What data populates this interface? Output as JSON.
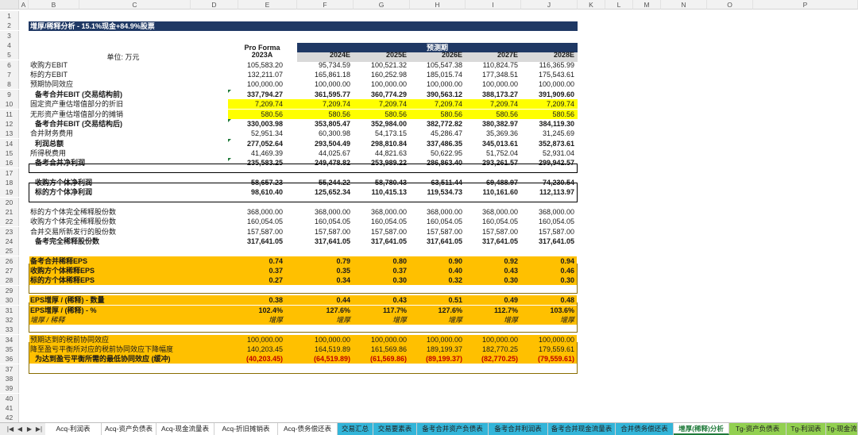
{
  "columns": [
    "A",
    "B",
    "C",
    "D",
    "E",
    "F",
    "G",
    "H",
    "I",
    "J",
    "K",
    "L",
    "M",
    "N",
    "O",
    "P"
  ],
  "title": "增厚/稀释分析 - 15.1%现金+84.9%股票",
  "unit_label": "单位: 万元",
  "proforma_label": "Pro Forma",
  "forecast_label": "预测期",
  "years": [
    "2023A",
    "2024E",
    "2025E",
    "2026E",
    "2027E",
    "2028E"
  ],
  "rows": [
    {
      "r": 6,
      "label": "收购方EBIT",
      "v": [
        "105,583.20",
        "95,734.59",
        "100,521.32",
        "105,547.38",
        "110,824.75",
        "116,365.99"
      ]
    },
    {
      "r": 7,
      "label": "标的方EBIT",
      "v": [
        "132,211.07",
        "165,861.18",
        "160,252.98",
        "185,015.74",
        "177,348.51",
        "175,543.61"
      ]
    },
    {
      "r": 8,
      "label": "预期协同效应",
      "v": [
        "100,000.00",
        "100,000.00",
        "100,000.00",
        "100,000.00",
        "100,000.00",
        "100,000.00"
      ]
    },
    {
      "r": 9,
      "label": "备考合并EBIT (交易结构前)",
      "v": [
        "337,794.27",
        "361,595.77",
        "360,774.29",
        "390,563.12",
        "388,173.27",
        "391,909.60"
      ],
      "bold": true,
      "indent": true
    },
    {
      "r": 10,
      "label": "固定资产重估增值部分的折旧",
      "v": [
        "7,209.74",
        "7,209.74",
        "7,209.74",
        "7,209.74",
        "7,209.74",
        "7,209.74"
      ],
      "hl": "yellow"
    },
    {
      "r": 11,
      "label": "无形资产重估增值部分的摊销",
      "v": [
        "580.56",
        "580.56",
        "580.56",
        "580.56",
        "580.56",
        "580.56"
      ],
      "hl": "yellow"
    },
    {
      "r": 12,
      "label": "备考合并EBIT (交易结构后)",
      "v": [
        "330,003.98",
        "353,805.47",
        "352,984.00",
        "382,772.82",
        "380,382.97",
        "384,119.30"
      ],
      "bold": true,
      "indent": true
    },
    {
      "r": 13,
      "label": "合并财务费用",
      "v": [
        "52,951.34",
        "60,300.98",
        "54,173.15",
        "45,286.47",
        "35,369.36",
        "31,245.69"
      ]
    },
    {
      "r": 14,
      "label": "利润总额",
      "v": [
        "277,052.64",
        "293,504.49",
        "298,810.84",
        "337,486.35",
        "345,013.61",
        "352,873.61"
      ],
      "bold": true,
      "indent": true
    },
    {
      "r": 15,
      "label": "所得税费用",
      "v": [
        "41,469.39",
        "44,025.67",
        "44,821.63",
        "50,622.95",
        "51,752.04",
        "52,931.04"
      ]
    },
    {
      "r": 16,
      "label": "备考合并净利润",
      "v": [
        "235,583.25",
        "249,478.82",
        "253,989.22",
        "286,863.40",
        "293,261.57",
        "299,942.57"
      ],
      "bold": true,
      "indent": true
    },
    {
      "r": 18,
      "label": "收购方个体净利润",
      "v": [
        "58,657.23",
        "55,244.22",
        "58,780.43",
        "63,511.44",
        "69,488.97",
        "74,230.54"
      ],
      "bold": true,
      "indent": true
    },
    {
      "r": 19,
      "label": "标的方个体净利润",
      "v": [
        "98,610.40",
        "125,652.34",
        "110,415.13",
        "119,534.73",
        "110,161.60",
        "112,113.97"
      ],
      "bold": true,
      "indent": true
    },
    {
      "r": 21,
      "label": "标的方个体完全稀释股份数",
      "v": [
        "368,000.00",
        "368,000.00",
        "368,000.00",
        "368,000.00",
        "368,000.00",
        "368,000.00"
      ]
    },
    {
      "r": 22,
      "label": "收购方个体完全稀释股份数",
      "v": [
        "160,054.05",
        "160,054.05",
        "160,054.05",
        "160,054.05",
        "160,054.05",
        "160,054.05"
      ]
    },
    {
      "r": 23,
      "label": "合并交易所新发行的股份数",
      "v": [
        "157,587.00",
        "157,587.00",
        "157,587.00",
        "157,587.00",
        "157,587.00",
        "157,587.00"
      ]
    },
    {
      "r": 24,
      "label": "备考完全稀释股份数",
      "v": [
        "317,641.05",
        "317,641.05",
        "317,641.05",
        "317,641.05",
        "317,641.05",
        "317,641.05"
      ],
      "bold": true,
      "indent": true
    },
    {
      "r": 26,
      "label": "备考合并稀释EPS",
      "v": [
        "0.74",
        "0.79",
        "0.80",
        "0.90",
        "0.92",
        "0.94"
      ],
      "bold": true,
      "hl": "orange"
    },
    {
      "r": 27,
      "label": "收购方个体稀释EPS",
      "v": [
        "0.37",
        "0.35",
        "0.37",
        "0.40",
        "0.43",
        "0.46"
      ],
      "bold": true,
      "hl": "orange"
    },
    {
      "r": 28,
      "label": "标的方个体稀释EPS",
      "v": [
        "0.27",
        "0.34",
        "0.30",
        "0.32",
        "0.30",
        "0.30"
      ],
      "bold": true,
      "hl": "orange"
    },
    {
      "r": 30,
      "label": "EPS增厚 / (稀释) - 数量",
      "v": [
        "0.38",
        "0.44",
        "0.43",
        "0.51",
        "0.49",
        "0.48"
      ],
      "bold": true,
      "hl": "orange"
    },
    {
      "r": 31,
      "label": "EPS增厚 / (稀释) - %",
      "v": [
        "102.4%",
        "127.6%",
        "117.7%",
        "127.6%",
        "112.7%",
        "103.6%"
      ],
      "bold": true,
      "hl": "orange"
    },
    {
      "r": 32,
      "label": "增厚 / 稀释",
      "v": [
        "增厚",
        "增厚",
        "增厚",
        "增厚",
        "增厚",
        "增厚"
      ],
      "ital": true,
      "hl": "orange"
    },
    {
      "r": 34,
      "label": "预期达到的税前协同效应",
      "v": [
        "100,000.00",
        "100,000.00",
        "100,000.00",
        "100,000.00",
        "100,000.00",
        "100,000.00"
      ],
      "hl": "orange"
    },
    {
      "r": 35,
      "label": "降至盈亏平衡所对应的税前协同效应下降幅度",
      "v": [
        "140,203.45",
        "164,519.89",
        "161,569.86",
        "189,199.37",
        "182,770.25",
        "179,559.61"
      ],
      "hl": "orange"
    },
    {
      "r": 36,
      "label": "为达到盈亏平衡所需的最低协同效应 (缓冲)",
      "v": [
        "(40,203.45)",
        "(64,519.89)",
        "(61,569.86)",
        "(89,199.37)",
        "(82,770.25)",
        "(79,559.61)"
      ],
      "bold": true,
      "indent": true,
      "hl": "orange",
      "red": true
    }
  ],
  "tabs": [
    "Acq-利润表",
    "Acq-资产负债表",
    "Acq-现金流量表",
    "Acq-折旧摊销表",
    "Acq-债务偿还表",
    "交易汇总",
    "交易要素表",
    "备考合并资产负债表",
    "备考合并利润表",
    "备考合并现金流量表",
    "合并债务偿还表",
    "增厚(稀释)分析",
    "Tg-资产负债表",
    "Tg-利润表",
    "Tg-现金流"
  ],
  "active_tab": "增厚(稀释)分析",
  "colors": {
    "header_navy": "#1f3864",
    "highlight_yellow": "#ffff00",
    "highlight_orange": "#ffc000",
    "negative_red": "#c00000",
    "tab_teal": "#33b5d9",
    "tab_green": "#92d050"
  }
}
